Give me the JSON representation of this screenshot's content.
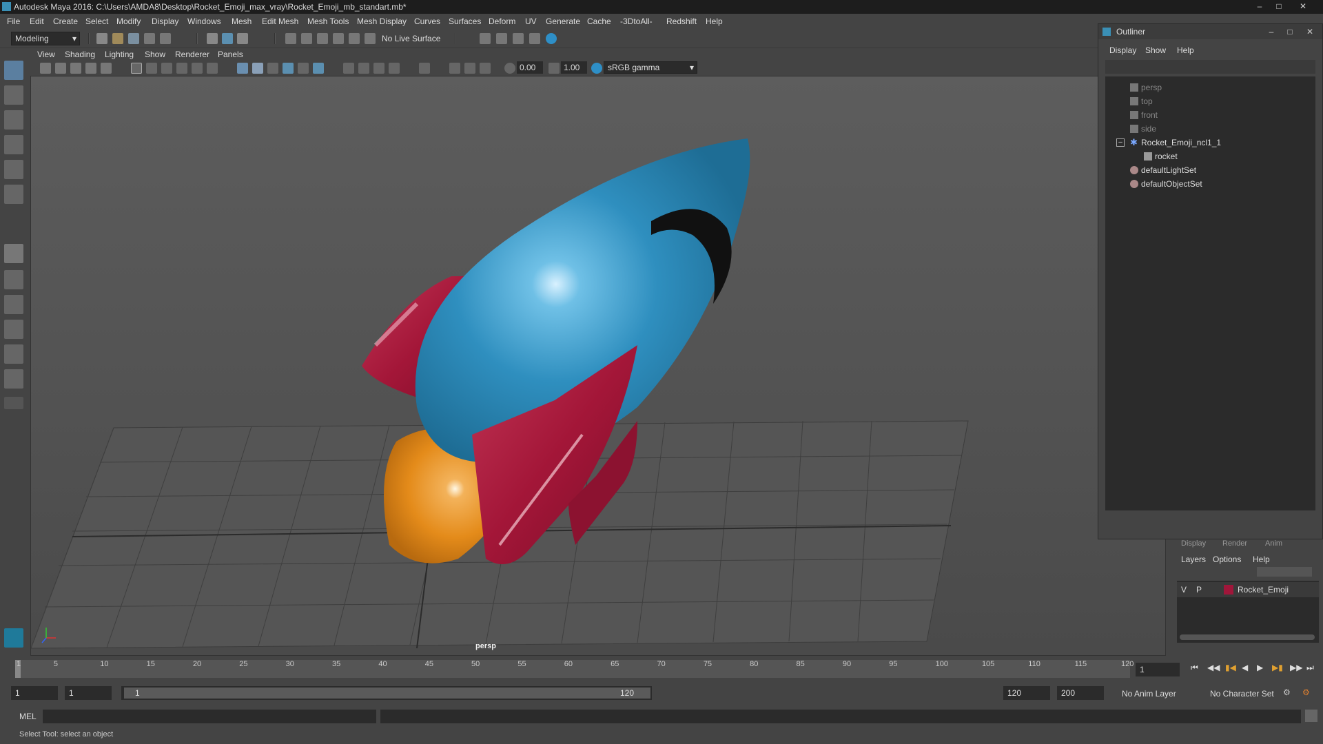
{
  "title_bar": {
    "title": "Autodesk Maya 2016: C:\\Users\\AMDA8\\Desktop\\Rocket_Emoji_max_vray\\Rocket_Emoji_mb_standart.mb*"
  },
  "menu": [
    "File",
    "Edit",
    "Create",
    "Select",
    "Modify",
    "Display",
    "Windows",
    "Mesh",
    "Edit Mesh",
    "Mesh Tools",
    "Mesh Display",
    "Curves",
    "Surfaces",
    "Deform",
    "UV",
    "Generate",
    "Cache",
    "-3DtoAll-",
    "Redshift",
    "Help"
  ],
  "toolbar": {
    "mode": "Modeling",
    "live_surface": "No Live Surface"
  },
  "panel_menu": [
    "View",
    "Shading",
    "Lighting",
    "Show",
    "Renderer",
    "Panels"
  ],
  "panel_toolbar": {
    "exposure": "0.00",
    "gamma": "1.00",
    "color_space": "sRGB gamma"
  },
  "viewport": {
    "camera_label": "persp"
  },
  "outliner": {
    "title": "Outliner",
    "menu": [
      "Display",
      "Show",
      "Help"
    ],
    "items": [
      {
        "label": "persp",
        "dim": true
      },
      {
        "label": "top",
        "dim": true
      },
      {
        "label": "front",
        "dim": true
      },
      {
        "label": "side",
        "dim": true
      },
      {
        "label": "Rocket_Emoji_ncl1_1",
        "dim": false
      },
      {
        "label": "rocket",
        "dim": false
      },
      {
        "label": "defaultLightSet",
        "dim": false
      },
      {
        "label": "defaultObjectSet",
        "dim": false
      }
    ]
  },
  "layer_editor": {
    "tabs": [
      "Display",
      "Render",
      "Anim"
    ],
    "menu": [
      "Layers",
      "Options",
      "Help"
    ],
    "layer": {
      "v": "V",
      "p": "P",
      "name": "Rocket_Emoji",
      "color": "#a0163a"
    }
  },
  "timeline": {
    "ticks": [
      "1",
      "5",
      "10",
      "15",
      "20",
      "25",
      "30",
      "35",
      "40",
      "45",
      "50",
      "55",
      "60",
      "65",
      "70",
      "75",
      "80",
      "85",
      "90",
      "95",
      "100",
      "105",
      "110",
      "115",
      "120"
    ],
    "current_frame": "1"
  },
  "range": {
    "start": "1",
    "playback_start": "1",
    "slider_start": "1",
    "slider_end": "120",
    "playback_end": "120",
    "end": "200",
    "anim_layer": "No Anim Layer",
    "character_set": "No Character Set"
  },
  "command_line": {
    "label": "MEL"
  },
  "help_line": {
    "text": "Select Tool: select an object"
  }
}
